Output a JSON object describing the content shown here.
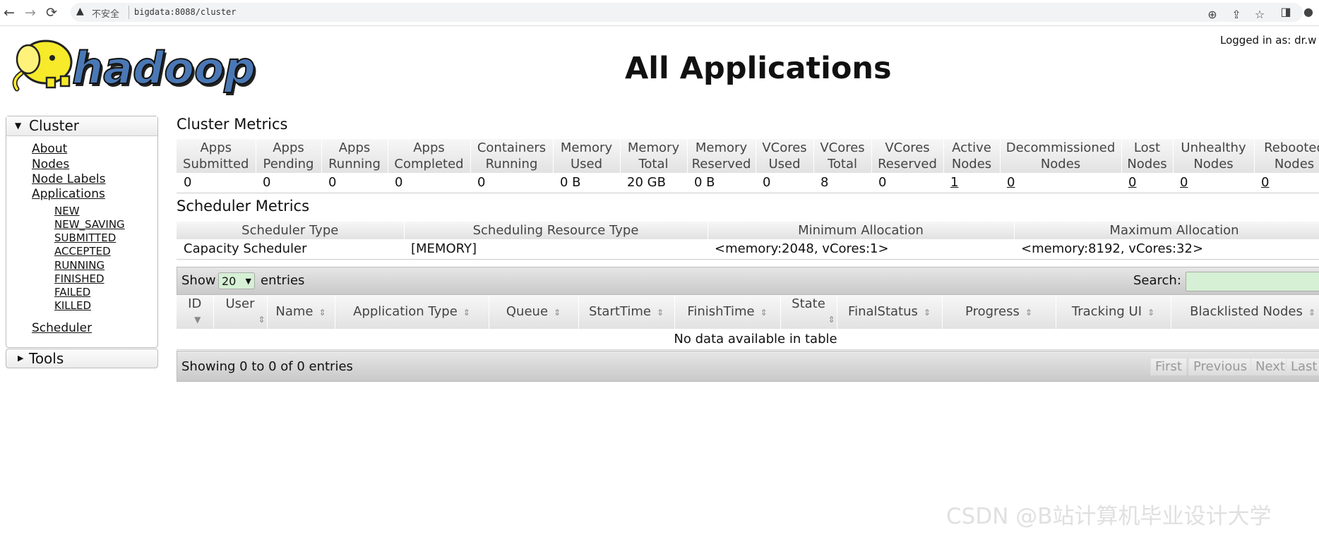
{
  "browser": {
    "back_icon": "←",
    "forward_icon": "→",
    "reload_icon": "⟳",
    "insecure_label": "不安全",
    "url": "bigdata:8088/cluster"
  },
  "header": {
    "logo_text": "hadoop",
    "title": "All Applications",
    "logged_in": "Logged in as: dr.w"
  },
  "sidebar": {
    "cluster_label": "Cluster",
    "links": [
      "About",
      "Nodes",
      "Node Labels",
      "Applications"
    ],
    "app_states": [
      "NEW",
      "NEW_SAVING",
      "SUBMITTED",
      "ACCEPTED",
      "RUNNING",
      "FINISHED",
      "FAILED",
      "KILLED"
    ],
    "scheduler": "Scheduler",
    "tools_label": "Tools"
  },
  "cluster_metrics": {
    "title": "Cluster Metrics",
    "headers": [
      [
        "Apps",
        "Submitted"
      ],
      [
        "Apps",
        "Pending"
      ],
      [
        "Apps",
        "Running"
      ],
      [
        "Apps",
        "Completed"
      ],
      [
        "Containers",
        "Running"
      ],
      [
        "Memory",
        "Used"
      ],
      [
        "Memory",
        "Total"
      ],
      [
        "Memory",
        "Reserved"
      ],
      [
        "VCores",
        "Used"
      ],
      [
        "VCores",
        "Total"
      ],
      [
        "VCores",
        "Reserved"
      ],
      [
        "Active",
        "Nodes"
      ],
      [
        "Decommissioned",
        "Nodes"
      ],
      [
        "Lost",
        "Nodes"
      ],
      [
        "Unhealthy",
        "Nodes"
      ],
      [
        "Rebooted",
        "Nodes"
      ]
    ],
    "values": [
      "0",
      "0",
      "0",
      "0",
      "0",
      "0 B",
      "20 GB",
      "0 B",
      "0",
      "8",
      "0",
      "1",
      "0",
      "0",
      "0",
      "0"
    ]
  },
  "scheduler_metrics": {
    "title": "Scheduler Metrics",
    "headers": [
      "Scheduler Type",
      "Scheduling Resource Type",
      "Minimum Allocation",
      "Maximum Allocation"
    ],
    "values": [
      "Capacity Scheduler",
      "[MEMORY]",
      "<memory:2048, vCores:1>",
      "<memory:8192, vCores:32>"
    ]
  },
  "apps_table": {
    "show_label": "Show",
    "page_size": "20",
    "entries_label": "entries",
    "search_label": "Search:",
    "columns": [
      "ID",
      "User",
      "Name",
      "Application Type",
      "Queue",
      "StartTime",
      "FinishTime",
      "State",
      "FinalStatus",
      "Progress",
      "Tracking UI",
      "Blacklisted Nodes"
    ],
    "empty_message": "No data available in table",
    "info": "Showing 0 to 0 of 0 entries",
    "pagination": [
      "First",
      "Previous",
      "Next",
      "Last"
    ]
  },
  "watermark": "CSDN @B站计算机毕业设计大学"
}
